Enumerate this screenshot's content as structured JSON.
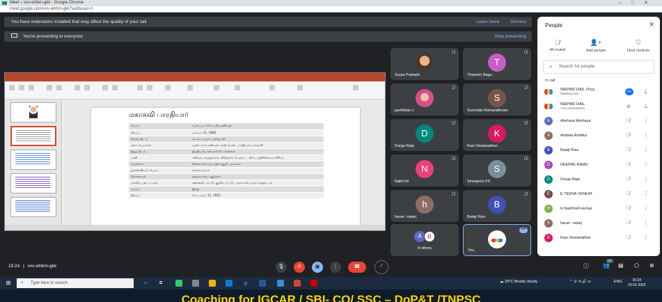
{
  "window": {
    "title": "Meet – vvv-whbm-gkk - Google Chrome",
    "url": "meet.google.com/vvv-whbm-gkk?authuser=1"
  },
  "banners": {
    "extensions": {
      "text": "You have extensions installed that may affect the quality of your call",
      "learn_more": "Learn more",
      "dismiss": "Dismiss"
    },
    "presenting": {
      "text": "You're presenting to everyone",
      "stop": "Stop presenting"
    }
  },
  "slide": {
    "title": "மகாகவி பாரதியார்",
    "rows": [
      [
        "பெயர்",
        "சுப்பையா (எ) சுப்பிரமணியன்"
      ],
      [
        "பிறப்பு",
        "டிசம்பர் 11, 1882"
      ],
      [
        "பிறந்த இடம்",
        "எட்டையபுரம், தமிழ்நாடு"
      ],
      [
        "மற்ற பெயர்கள்",
        "முண்டாசுக் கவிஞன், சக்தி தாசன், பாரதியார், மகாகவி"
      ],
      [
        "இறுப்பிடம்",
        "இந்தியா/பாண்டிச்சேரி, சென்னை"
      ],
      [
        "பணி",
        "கவிஞர், எழுத்தாளர், விடுதலை போராட்ட வீரர், பத்திரிக்கையாசிரியர்"
      ],
      [
        "பெற்றோர்",
        "சின்னசாமி ஐயர், இலக்குமி அம்மாள்"
      ],
      [
        "துணைவியார் பெயர்",
        "செல்லம்மாள்"
      ],
      [
        "பிள்ளைகள்",
        "தங்கம்மாள், சகுந்தலா"
      ],
      [
        "முக்கிய படைப்புகள்",
        "கண்ணன் பாட்டு, குயில் பாட்டு, பாஞ்சாலி சபதம் மற்றும் பல"
      ],
      [
        "சமயம்",
        "இந்து"
      ],
      [
        "இறப்பு",
        "செப்டம்பர் 11, 1921"
      ]
    ]
  },
  "tiles": [
    {
      "name": "Surya Prakash",
      "initial": "",
      "color": "photo"
    },
    {
      "name": "Thamizh Nagu",
      "initial": "T",
      "color": "#c560c4"
    },
    {
      "name": "parthiban v",
      "initial": "",
      "color": "photo2"
    },
    {
      "name": "Surendar Ramarathnam",
      "initial": "S",
      "color": "#795548"
    },
    {
      "name": "Durga Raja",
      "initial": "D",
      "color": "#00897b"
    },
    {
      "name": "Kasi Viswanathan",
      "initial": "K",
      "color": "#d81b60"
    },
    {
      "name": "Nalini M",
      "initial": "N",
      "color": "#ec407a"
    },
    {
      "name": "Siranjeevi VS",
      "initial": "S",
      "color": "#78909c"
    },
    {
      "name": "haran` natarj",
      "initial": "h",
      "color": "#8d6e63"
    },
    {
      "name": "Balaji Ravi",
      "initial": "B",
      "color": "#3f51b5"
    }
  ],
  "others": {
    "label": "8 others",
    "a": "A",
    "r": "R"
  },
  "you": {
    "label": "You"
  },
  "meetbar": {
    "time": "15:24",
    "code": "vvv-whbm-gkk",
    "participants_badge": "20"
  },
  "people_panel": {
    "title": "People",
    "actions": {
      "all_muted": "All muted",
      "add_people": "Add people",
      "host_controls": "Host controls"
    },
    "search_placeholder": "Search for people",
    "section": "In call",
    "participants": [
      {
        "name": "NIEPMD DAIL (You)",
        "sub": "Meeting host",
        "initial": "",
        "color": "logo"
      },
      {
        "name": "NIEPMD DAIL",
        "sub": "Your presentation",
        "initial": "",
        "color": "logo"
      },
      {
        "name": "Akshaya Akshaya",
        "sub": "",
        "initial": "A",
        "color": "#5c6bc0"
      },
      {
        "name": "Ambika Ambika",
        "sub": "",
        "initial": "A",
        "color": "#8d6e63"
      },
      {
        "name": "Balaji Ravi",
        "sub": "",
        "initial": "B",
        "color": "#3f51b5"
      },
      {
        "name": "DEEPAK RAMU",
        "sub": "",
        "initial": "D",
        "color": "#ab47bc"
      },
      {
        "name": "Durga Raja",
        "sub": "",
        "initial": "D",
        "color": "#00897b"
      },
      {
        "name": "E.TEENA VENKAT",
        "sub": "",
        "initial": "E",
        "color": "#6d4c41"
      },
      {
        "name": "H.Santhosh kumar",
        "sub": "",
        "initial": "H",
        "color": "#7cb342"
      },
      {
        "name": "haran` natarj",
        "sub": "",
        "initial": "h",
        "color": "#8d6e63"
      },
      {
        "name": "Kasi Viswanathan",
        "sub": "",
        "initial": "K",
        "color": "#d81b60"
      }
    ]
  },
  "taskbar": {
    "search": "Type here to search",
    "weather": "29°C  Mostly cloudy",
    "lang": "ENG",
    "time": "15:24",
    "date": "19-01-2022"
  },
  "caption": "Coaching for IGCAR / SBI- CO/ SSC – DoP&T /TNPSC"
}
